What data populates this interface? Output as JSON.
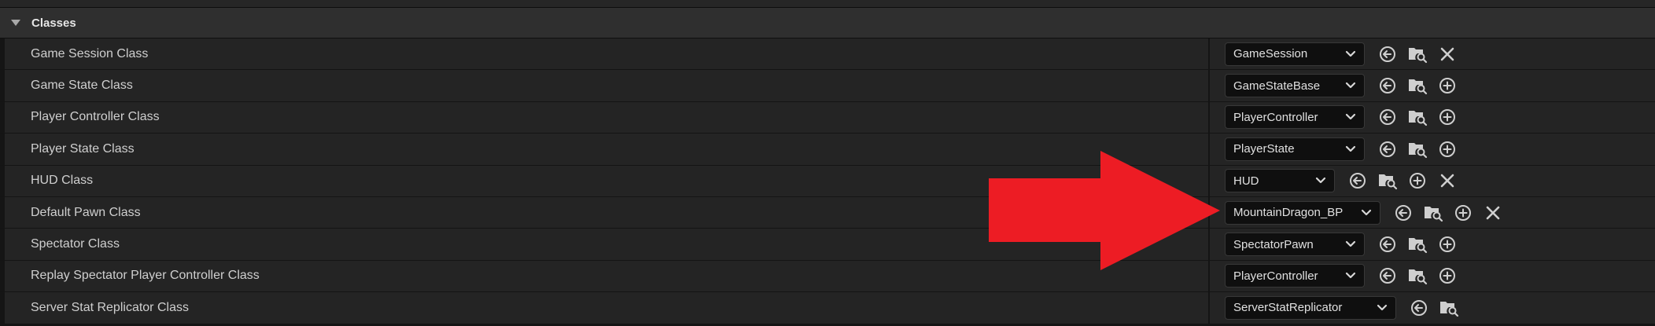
{
  "section": {
    "title": "Classes"
  },
  "rows": [
    {
      "label": "Game Session Class",
      "value": "GameSession",
      "actions": [
        "browse-back-icon",
        "folder-search-icon",
        "clear-icon"
      ]
    },
    {
      "label": "Game State Class",
      "value": "GameStateBase",
      "actions": [
        "browse-back-icon",
        "folder-search-icon",
        "add-icon"
      ]
    },
    {
      "label": "Player Controller Class",
      "value": "PlayerController",
      "actions": [
        "browse-back-icon",
        "folder-search-icon",
        "add-icon"
      ]
    },
    {
      "label": "Player State Class",
      "value": "PlayerState",
      "actions": [
        "browse-back-icon",
        "folder-search-icon",
        "add-icon"
      ]
    },
    {
      "label": "HUD Class",
      "value": "HUD",
      "actions": [
        "browse-back-icon",
        "folder-search-icon",
        "add-icon",
        "clear-icon"
      ]
    },
    {
      "label": "Default Pawn Class",
      "value": "MountainDragon_BP",
      "actions": [
        "browse-back-icon",
        "folder-search-icon",
        "add-icon",
        "clear-icon"
      ]
    },
    {
      "label": "Spectator Class",
      "value": "SpectatorPawn",
      "actions": [
        "browse-back-icon",
        "folder-search-icon",
        "add-icon"
      ]
    },
    {
      "label": "Replay Spectator Player Controller Class",
      "value": "PlayerController",
      "actions": [
        "browse-back-icon",
        "folder-search-icon",
        "add-icon"
      ]
    },
    {
      "label": "Server Stat Replicator Class",
      "value": "ServerStatReplicator",
      "actions": [
        "browse-back-icon",
        "folder-search-icon"
      ]
    }
  ],
  "annotation": {
    "arrow_color": "#ed1c24",
    "points_to_row": "Default Pawn Class"
  },
  "colors": {
    "background": "#151515",
    "row": "#242424",
    "header": "#2f2f2f",
    "combo": "#0f0f0f",
    "text": "#cfcfcf",
    "icon": "#cfcfcf"
  }
}
